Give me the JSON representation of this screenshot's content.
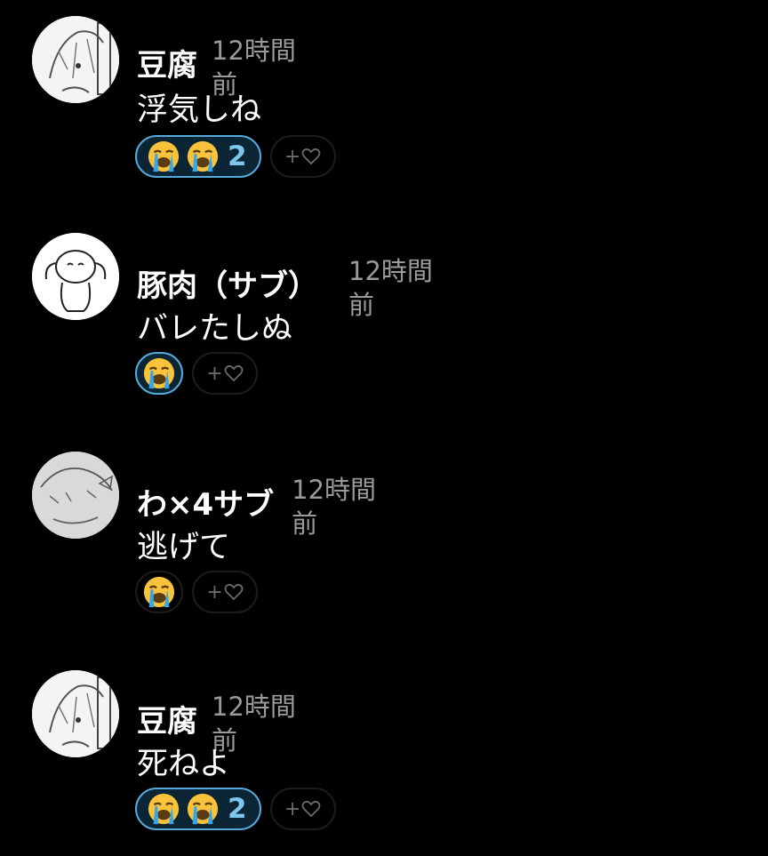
{
  "comments": [
    {
      "author": "豆腐",
      "time": "12時間前",
      "message": "浮気しね",
      "reaction_count": "2"
    },
    {
      "author": "豚肉（サブ）",
      "time": "12時間前",
      "message": "バレたしぬ",
      "reaction_count": ""
    },
    {
      "author": "わ×4サブ",
      "time": "12時間前",
      "message": "逃げて",
      "reaction_count": ""
    },
    {
      "author": "豆腐",
      "time": "12時間前",
      "message": "死ねよ",
      "reaction_count": "2"
    }
  ],
  "add_reaction_label": "+",
  "reaction_emoji": "crying-face-icon",
  "colors": {
    "background": "#000000",
    "time_text": "#9a9a9a",
    "reaction_active_border": "#57a9da",
    "reaction_count": "#7dc7ee"
  }
}
